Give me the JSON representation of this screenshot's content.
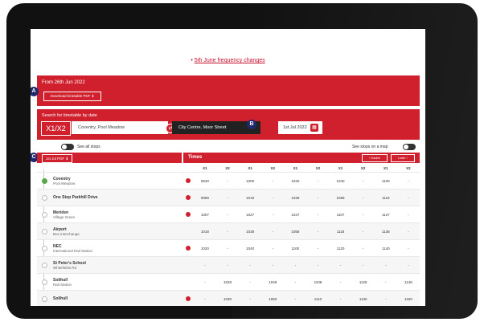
{
  "link": "5th June frequency changes",
  "markers": [
    "A",
    "B",
    "C"
  ],
  "band1": {
    "from": "From 26th Jun 2022",
    "download": "Download timetable PDF"
  },
  "band2": {
    "label": "Search for timetable by date",
    "route": "X1/X2",
    "from_value": "Coventry, Pool Meadow",
    "to_value": "City Centre, Moor Street",
    "date_value": "1st Jul 2022"
  },
  "see_all": "See all stops",
  "see_map": "See stops on a map",
  "pdf_short": "1st Jul PDF",
  "times_title": "Times",
  "nav": {
    "earlier": "Earlier",
    "later": "Later"
  },
  "columns": [
    "X1",
    "X2",
    "X1",
    "X2",
    "X1",
    "X2",
    "X1",
    "X2",
    "X1",
    "X2"
  ],
  "rows": [
    {
      "name": "Coventry",
      "sub": "Pool Meadow",
      "times": [
        "0940",
        "-",
        "1000",
        "-",
        "1020",
        "-",
        "1040",
        "-",
        "1100",
        "-"
      ],
      "first": true,
      "red": true
    },
    {
      "name": "One Stop Parkhill Drive",
      "sub": "",
      "times": [
        "0959",
        "-",
        "1019",
        "-",
        "1039",
        "-",
        "1059",
        "-",
        "1119",
        "-"
      ],
      "red": true
    },
    {
      "name": "Meriden",
      "sub": "Village Green",
      "times": [
        "1007",
        "-",
        "1027",
        "-",
        "1047",
        "-",
        "1107",
        "-",
        "1127",
        "-"
      ],
      "red": true
    },
    {
      "name": "Airport",
      "sub": "Bus Interchange",
      "times": [
        "1018",
        "-",
        "1038",
        "-",
        "1058",
        "-",
        "1118",
        "-",
        "1138",
        "-"
      ]
    },
    {
      "name": "NEC",
      "sub": "International Rail Station",
      "times": [
        "1020",
        "-",
        "1040",
        "-",
        "1100",
        "-",
        "1120",
        "-",
        "1140",
        "-"
      ],
      "red": true
    },
    {
      "name": "St Peter's School",
      "sub": "Whitefields Rd",
      "times": [
        "-",
        "-",
        "-",
        "-",
        "-",
        "-",
        "-",
        "-",
        "-",
        "-"
      ]
    },
    {
      "name": "Solihull",
      "sub": "Rail Station",
      "times": [
        "-",
        "1028",
        "-",
        "1048",
        "-",
        "1108",
        "-",
        "1128",
        "-",
        "1148"
      ]
    },
    {
      "name": "Solihull",
      "sub": "",
      "times": [
        "-",
        "1030",
        "-",
        "1050",
        "-",
        "1110",
        "-",
        "1130",
        "-",
        "1150"
      ],
      "red": true
    }
  ]
}
